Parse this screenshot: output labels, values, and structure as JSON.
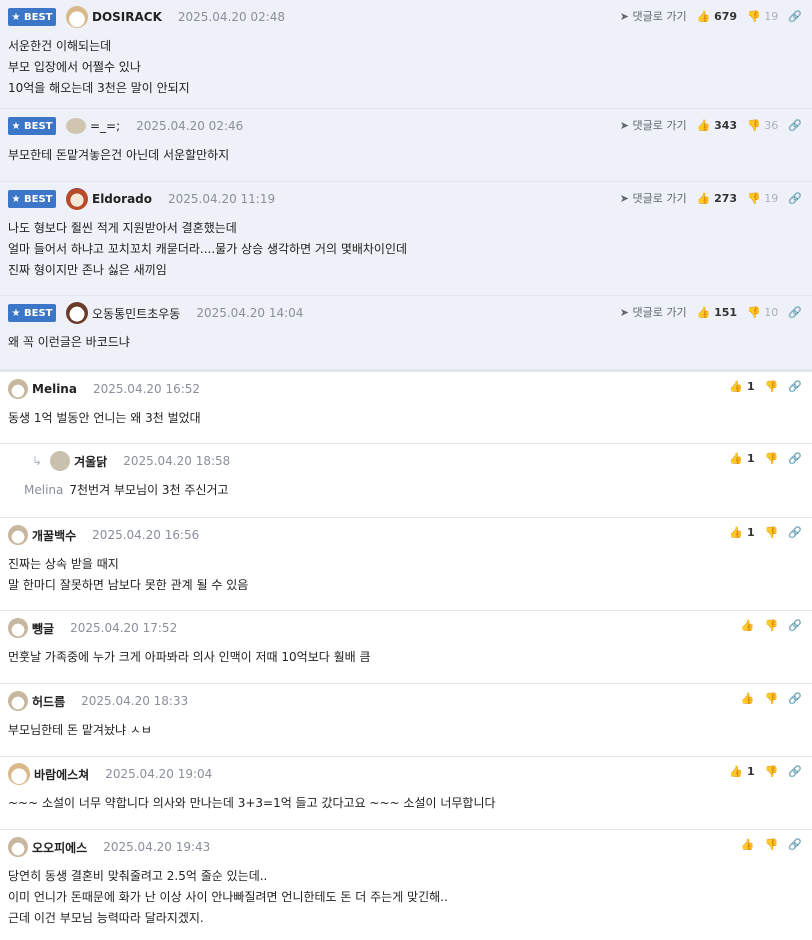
{
  "labels": {
    "best": "BEST",
    "reply_link": "댓글로 가기"
  },
  "best_comments": [
    {
      "user": "DOSIRACK",
      "date": "2025.04.20 02:48",
      "up": "679",
      "down": "19",
      "lines": [
        "서운한건 이해되는데",
        "부모 입장에서 어쩔수 있나",
        "10억을 해오는데 3천은 말이 안되지"
      ]
    },
    {
      "user": "=_=;",
      "date": "2025.04.20 02:46",
      "up": "343",
      "down": "36",
      "lines": [
        "부모한테 돈맡겨놓은건 아닌데 서운할만하지"
      ]
    },
    {
      "user": "Eldorado",
      "date": "2025.04.20 11:19",
      "up": "273",
      "down": "19",
      "lines": [
        "나도 형보다 쥘씬 적게 지원받아서 결혼했는데",
        "얼마 들어서 하냐고 꼬치꼬치 캐묻더라....물가 상승 생각하면 거의 몇배차이인데",
        "진짜 형이지만 존나 싫은 새끼임"
      ]
    },
    {
      "user": "오동통민트초우동",
      "date": "2025.04.20 14:04",
      "up": "151",
      "down": "10",
      "lines": [
        "왜 꼭 이런글은 바코드냐"
      ]
    }
  ],
  "comments": [
    {
      "user": "Melina",
      "date": "2025.04.20 16:52",
      "up": "1",
      "lines": [
        "동생 1억 벌동안 언니는 왜 3천 벌었대"
      ]
    },
    {
      "user": "겨울닭",
      "date": "2025.04.20 18:58",
      "up": "1",
      "reply_to": "Melina",
      "lines": [
        "7천번겨 부모님이 3천 주신거고"
      ]
    },
    {
      "user": "개꿀백수",
      "date": "2025.04.20 16:56",
      "up": "1",
      "lines": [
        "진짜는 상속 받을 때지",
        "말 한마디 잘못하면 남보다 못한 관계 될 수 있음"
      ]
    },
    {
      "user": "뺑글",
      "date": "2025.04.20 17:52",
      "up": "",
      "lines": [
        "먼훗날 가족중에 누가 크게 아파봐라 의사 인맥이 저때 10억보다 훨배 큼"
      ]
    },
    {
      "user": "허드름",
      "date": "2025.04.20 18:33",
      "up": "",
      "lines": [
        "부모님한테 돈 맡겨놨냐 ㅅㅂ"
      ]
    },
    {
      "user": "바람에스쳐",
      "date": "2025.04.20 19:04",
      "up": "1",
      "lines": [
        "~~~ 소설이 너무 약합니다 의사와 만나는데 3+3=1억 들고 갔다고요 ~~~ 소설이 너무합니다"
      ]
    },
    {
      "user": "오오피에스",
      "date": "2025.04.20 19:43",
      "up": "",
      "lines": [
        "당연히 동생 결혼비 맞춰줄려고 2.5억 줄순 있는데..",
        "이미 언니가 돈때문에 화가 난 이상 사이 안나빠질려면 언니한테도 돈 더 주는게 맞긴해..",
        "근데 이건 부모님 능력따라 달라지겠지."
      ]
    }
  ]
}
